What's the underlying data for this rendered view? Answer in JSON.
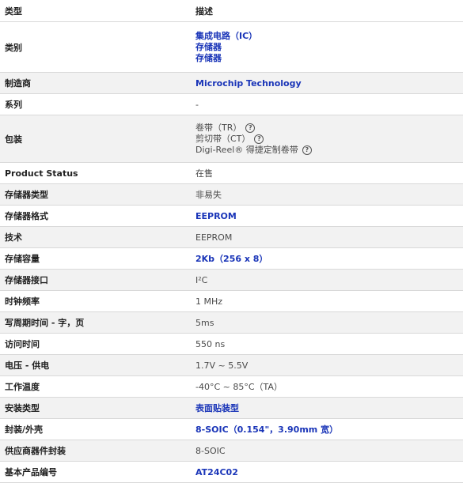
{
  "header": {
    "col1": "类型",
    "col2": "描述"
  },
  "rows": [
    {
      "key": "类别",
      "values": [
        "集成电路（IC）",
        "存储器",
        "存储器"
      ]
    },
    {
      "key": "制造商",
      "value": "Microchip Technology"
    },
    {
      "key": "系列",
      "value": "-"
    },
    {
      "key": "包装",
      "values": [
        "卷带（TR）",
        "剪切带（CT）",
        "Digi-Reel® 得捷定制卷带"
      ]
    },
    {
      "key": "Product Status",
      "value": "在售"
    },
    {
      "key": "存储器类型",
      "value": "非易失"
    },
    {
      "key": "存储器格式",
      "value": "EEPROM"
    },
    {
      "key": "技术",
      "value": "EEPROM"
    },
    {
      "key": "存储容量",
      "value": "2Kb（256 x 8）"
    },
    {
      "key": "存储器接口",
      "value": "I²C"
    },
    {
      "key": "时钟频率",
      "value": "1 MHz"
    },
    {
      "key": "写周期时间 - 字，页",
      "value": "5ms"
    },
    {
      "key": "访问时间",
      "value": "550 ns"
    },
    {
      "key": "电压 - 供电",
      "value": "1.7V ~ 5.5V"
    },
    {
      "key": "工作温度",
      "value": "-40°C ~ 85°C（TA）"
    },
    {
      "key": "安装类型",
      "value": "表面贴装型"
    },
    {
      "key": "封装/外壳",
      "value": "8-SOIC（0.154\"，3.90mm 宽）"
    },
    {
      "key": "供应商器件封装",
      "value": "8-SOIC"
    },
    {
      "key": "基本产品编号",
      "value": "AT24C02"
    }
  ],
  "icons": {
    "help": "question-circle-icon",
    "help_glyph": "?"
  },
  "colors": {
    "link": "#1a35b8",
    "row_alt": "#f2f2f2",
    "border": "#d9d9d9"
  }
}
